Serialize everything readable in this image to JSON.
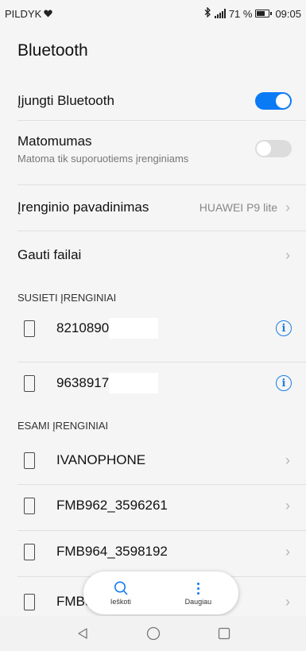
{
  "status_bar": {
    "carrier": "PILDYK",
    "battery_text": "71 %",
    "time": "09:05",
    "battery_level": 0.71,
    "icons": [
      "heart-icon",
      "bluetooth-icon",
      "signal-icon",
      "battery-icon"
    ]
  },
  "header": {
    "title": "Bluetooth"
  },
  "settings": {
    "enable_bluetooth": {
      "label": "Įjungti Bluetooth",
      "state": "on"
    },
    "visibility": {
      "label": "Matomumas",
      "sublabel": "Matoma tik suporuotiems įrenginiams",
      "state": "off"
    },
    "device_name": {
      "label": "Įrenginio pavadinimas",
      "value": "HUAWEI P9 lite"
    },
    "received_files": {
      "label": "Gauti failai"
    }
  },
  "paired": {
    "header": "SUSIETI ĮRENGINIAI",
    "devices": [
      {
        "name": "8210890"
      },
      {
        "name": "9638917"
      }
    ]
  },
  "available": {
    "header": "ESAMI ĮRENGINIAI",
    "devices": [
      {
        "name": "IVANOPHONE"
      },
      {
        "name": "FMB962_3596261"
      },
      {
        "name": "FMB964_3598192"
      },
      {
        "name": "FMB9"
      }
    ]
  },
  "fab": {
    "search_label": "Ieškoti",
    "more_label": "Daugiau"
  },
  "colors": {
    "accent": "#0a7af5",
    "background": "#f5f5f5",
    "divider": "#e0e0e0"
  }
}
